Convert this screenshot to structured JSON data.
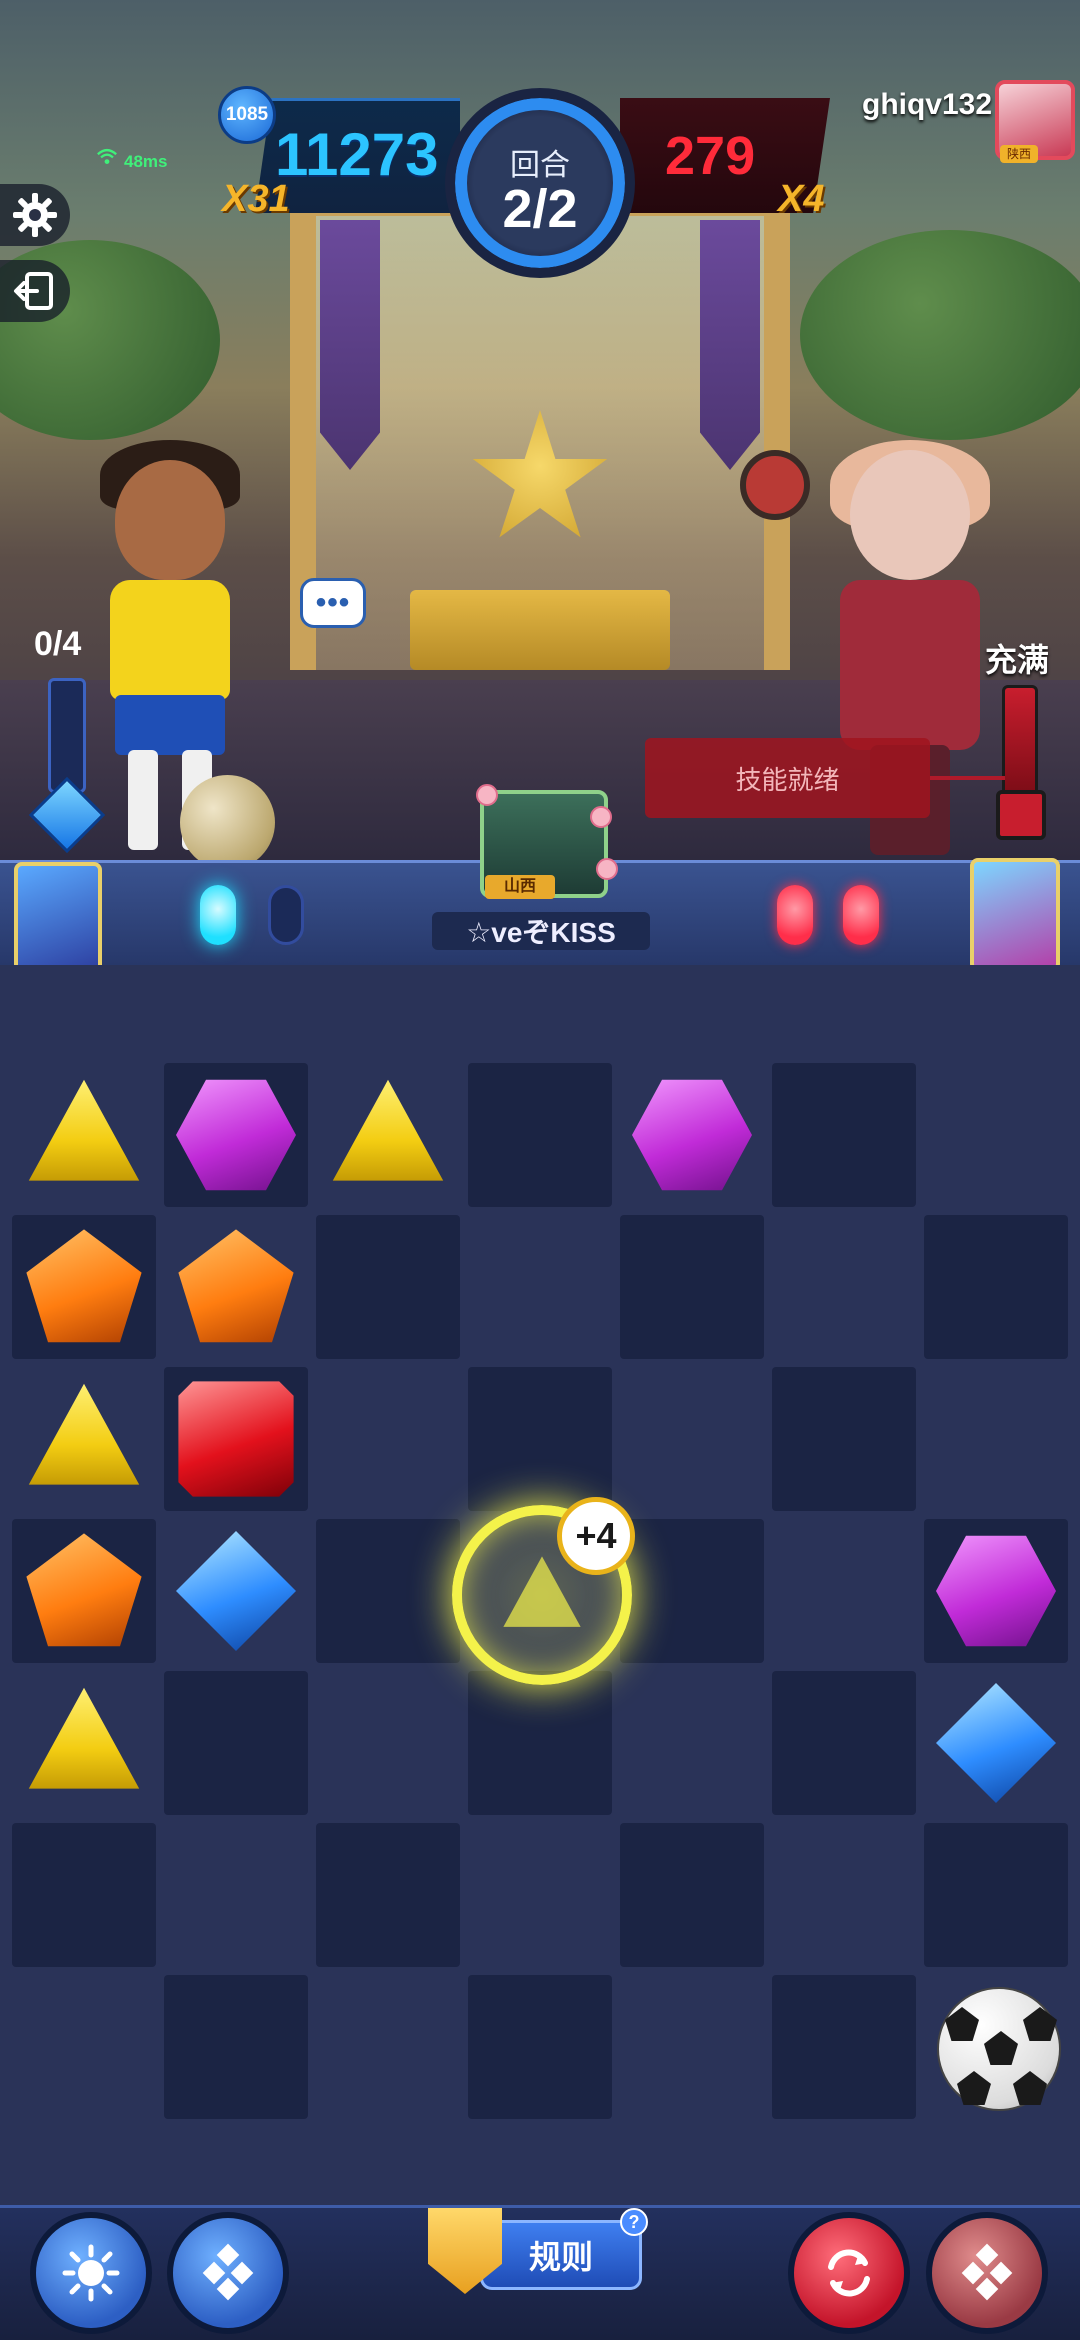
{
  "hud": {
    "player_level": "1085",
    "player_score": "11273",
    "player_multiplier": "X31",
    "opponent_score": "279",
    "opponent_multiplier": "X4",
    "round_label": "回合",
    "round_value": "2/2",
    "opponent_name": "ghiqv132",
    "opponent_avatar_tag": "陕西",
    "ping": "48ms"
  },
  "energy": {
    "player_count": "0/4",
    "opponent_status": "充满",
    "skill_ready_label": "技能就绪"
  },
  "chat": {
    "bubble_text": "•••"
  },
  "strip": {
    "player_title_tag": "山西",
    "player_name": "☆veぞKISS"
  },
  "board": {
    "special_badge": "+4",
    "gems": [
      "yellow",
      "purple",
      "orange",
      "red",
      "blue"
    ]
  },
  "bottom": {
    "rules_label": "规则",
    "rules_help": "?"
  },
  "colors": {
    "player_score": "#2cc4ff",
    "opponent_score": "#ff2b3a",
    "multiplier": "#f5b52a",
    "board_bg": "#2a3358",
    "tile": "#1b2444"
  }
}
